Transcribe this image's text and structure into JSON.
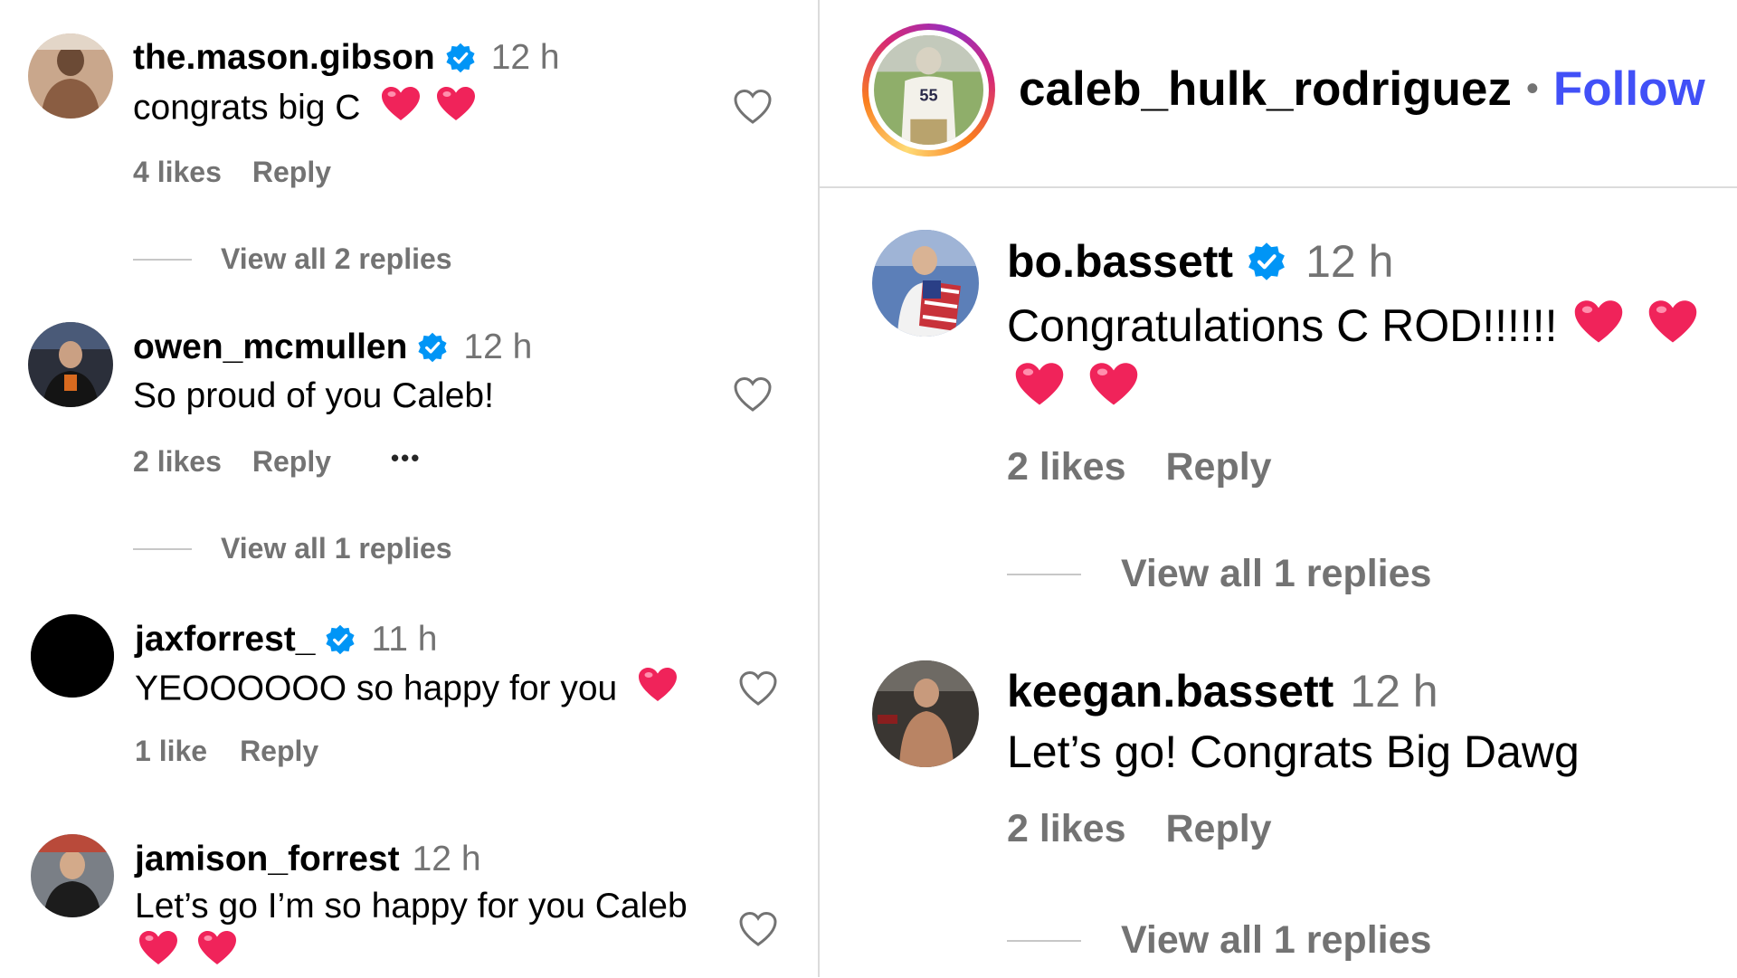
{
  "left": {
    "comments": [
      {
        "username": "the.mason.gibson",
        "verified": true,
        "time": "12 h",
        "text": "congrats big C",
        "hearts": 2,
        "likes": "4 likes",
        "reply": "Reply",
        "view_replies": "View all 2 replies"
      },
      {
        "username": "owen_mcmullen",
        "verified": true,
        "time": "12 h",
        "text": "So proud of you Caleb!",
        "hearts": 0,
        "likes": "2 likes",
        "reply": "Reply",
        "more": "•••",
        "view_replies": "View all 1 replies"
      },
      {
        "username": "jaxforrest_",
        "verified": true,
        "time": "11 h",
        "text": "YEOOOOOO so happy for you",
        "hearts": 1,
        "likes": "1 like",
        "reply": "Reply"
      },
      {
        "username": "jamison_forrest",
        "verified": false,
        "time": "12 h",
        "text": "Let’s go I’m so happy for you Caleb",
        "hearts": 2
      }
    ]
  },
  "right": {
    "header": {
      "username": "caleb_hulk_rodriguez",
      "separator": "•",
      "follow": "Follow",
      "jersey_number": "55"
    },
    "comments": [
      {
        "username": "bo.bassett",
        "verified": true,
        "time": "12 h",
        "text": "Congratulations C ROD!!!!!!",
        "hearts": 4,
        "likes": "2 likes",
        "reply": "Reply",
        "view_replies": "View all 1 replies"
      },
      {
        "username": "keegan.bassett",
        "verified": false,
        "time": "12 h",
        "text": "Let’s go! Congrats Big Dawg",
        "hearts": 0,
        "likes": "2 likes",
        "reply": "Reply",
        "view_replies": "View all 1 replies"
      }
    ]
  },
  "colors": {
    "verified": "#0095f6",
    "heart_emoji": "#f0235a",
    "follow": "#4150f7",
    "muted": "#737373"
  },
  "icons": {
    "verified": "verified-badge-icon",
    "like": "heart-outline-icon",
    "emoji": "red-heart-emoji",
    "more": "more-options-icon"
  }
}
